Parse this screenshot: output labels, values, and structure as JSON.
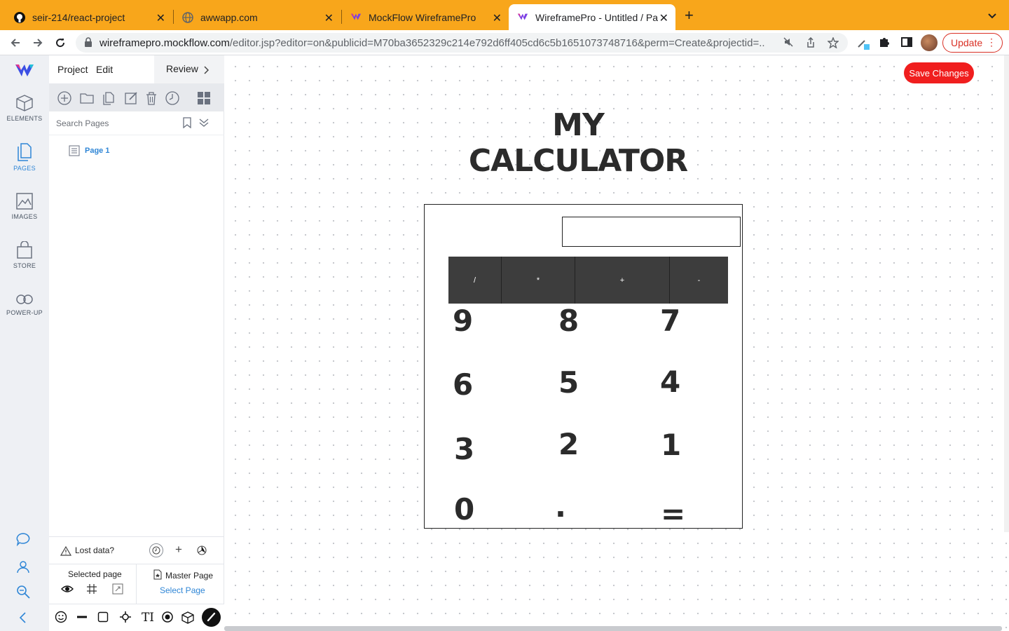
{
  "browser": {
    "tabs": [
      {
        "label": "seir-214/react-project",
        "icon": "github-icon"
      },
      {
        "label": "awwapp.com",
        "icon": "globe-icon"
      },
      {
        "label": "MockFlow WireframePro",
        "icon": "mockflow-icon"
      },
      {
        "label": "WireframePro - Untitled / Page",
        "icon": "mockflow-icon",
        "active": true
      }
    ],
    "new_tab": "+",
    "tab_menu": "⌄",
    "url_host": "wireframepro.mockflow.com",
    "url_rest": "/editor.jsp?editor=on&publicid=M70ba3652329c214e792d6ff405cd6c5b1651073748716&perm=Create&projectid=...",
    "update_label": "Update"
  },
  "rail": {
    "items": [
      {
        "label": "ELEMENTS",
        "icon": "cube-icon"
      },
      {
        "label": "PAGES",
        "icon": "pages-icon"
      },
      {
        "label": "IMAGES",
        "icon": "image-icon"
      },
      {
        "label": "STORE",
        "icon": "bag-icon"
      },
      {
        "label": "POWER-UP",
        "icon": "infinity-icon"
      }
    ]
  },
  "panel": {
    "menu": {
      "project": "Project",
      "edit": "Edit",
      "review": "Review"
    },
    "search_placeholder": "Search Pages",
    "pages": [
      {
        "label": "Page 1"
      }
    ],
    "lost_data": "Lost data?",
    "selected_page": "Selected page",
    "master_page": "Master Page",
    "select_page": "Select Page"
  },
  "canvas": {
    "save_label": "Save Changes",
    "title": "MY CALCULATOR",
    "operators": [
      "/",
      "*",
      "+",
      "-"
    ],
    "digits": [
      "9",
      "8",
      "7",
      "6",
      "5",
      "4",
      "3",
      "2",
      "1",
      "0",
      ".",
      "="
    ]
  },
  "colors": {
    "tab_bar": "#f8a61b",
    "accent": "#2f86d6",
    "save_button": "#f01e1e",
    "operator_bar": "#3d3d3d"
  }
}
